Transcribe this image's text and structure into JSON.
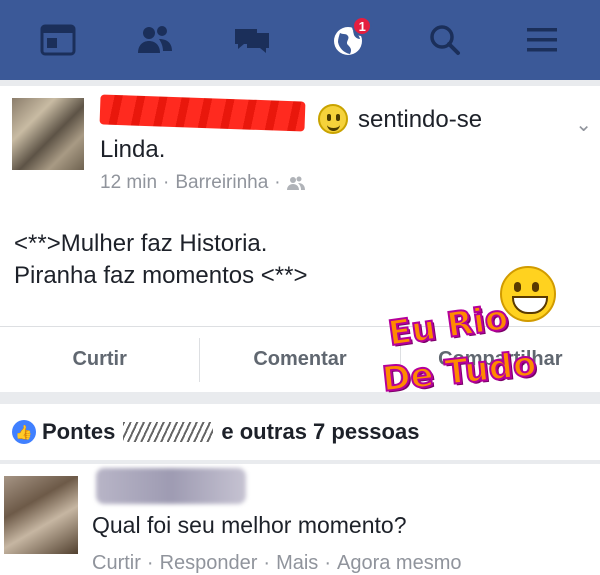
{
  "navbar": {
    "notification_count": "1",
    "items": [
      {
        "icon": "news-feed-icon"
      },
      {
        "icon": "friends-icon"
      },
      {
        "icon": "messages-icon"
      },
      {
        "icon": "globe-notifications-icon"
      },
      {
        "icon": "search-icon"
      },
      {
        "icon": "menu-icon"
      }
    ]
  },
  "post": {
    "feeling_prefix": "sentindo-se",
    "feeling_name": "Linda.",
    "time": "12 min",
    "separator": "·",
    "location": "Barreirinha",
    "text": "<**>Mulher faz Historia.\nPiranha faz momentos <**>",
    "actions": {
      "like": "Curtir",
      "comment": "Comentar",
      "share": "Compartilhar"
    }
  },
  "watermark": {
    "line1": "Eu Rio",
    "line2": "De Tudo"
  },
  "reactions": {
    "prefix": "Pontes",
    "suffix": "e outras 7 pessoas"
  },
  "comment": {
    "text": "Qual foi seu melhor momento?",
    "meta": {
      "like": "Curtir",
      "reply": "Responder",
      "more": "Mais",
      "time": "Agora mesmo",
      "sep": "·"
    }
  },
  "colors": {
    "navbar": "#3b5998",
    "badge": "#e41e3f",
    "like_blue": "#4080ff"
  }
}
